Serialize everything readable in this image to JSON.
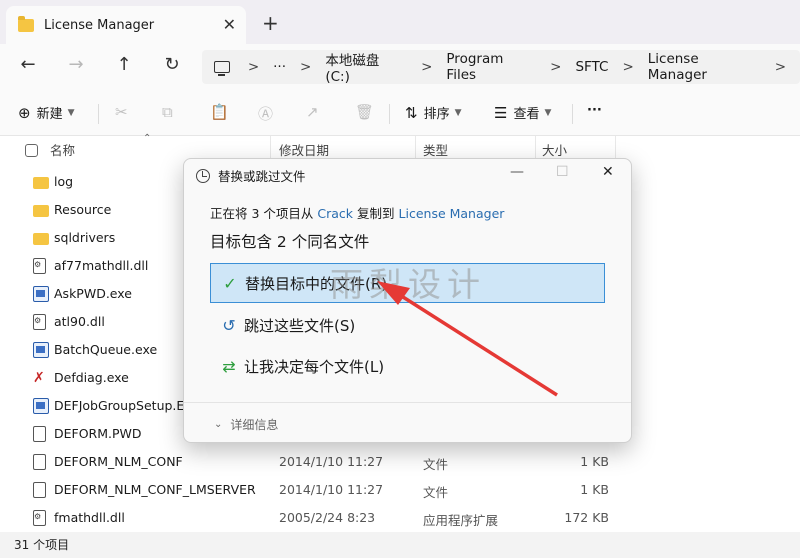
{
  "window": {
    "tab_title": "License Manager",
    "tab_close": "✕",
    "new_tab": "+"
  },
  "nav": {
    "back": "←",
    "forward": "→",
    "up": "↑",
    "refresh": "↻",
    "more": "···",
    "breadcrumbs": [
      "本地磁盘 (C:)",
      "Program Files",
      "SFTC",
      "License Manager"
    ],
    "sep": ">"
  },
  "toolbar": {
    "new_label": "新建",
    "sort_label": "排序",
    "view_label": "查看",
    "more": "···"
  },
  "columns": {
    "name": "名称",
    "modified": "修改日期",
    "type": "类型",
    "size": "大小"
  },
  "files": [
    {
      "name": "log",
      "icon": "folder-icon",
      "date": "",
      "type": "",
      "size": ""
    },
    {
      "name": "Resource",
      "icon": "folder-icon",
      "date": "",
      "type": "",
      "size": ""
    },
    {
      "name": "sqldrivers",
      "icon": "folder-icon",
      "date": "",
      "type": "",
      "size": ""
    },
    {
      "name": "af77mathdll.dll",
      "icon": "dll-icon",
      "date": "",
      "type": "",
      "size": ""
    },
    {
      "name": "AskPWD.exe",
      "icon": "exe-icon",
      "date": "",
      "type": "",
      "size": ""
    },
    {
      "name": "atl90.dll",
      "icon": "dll-icon",
      "date": "",
      "type": "",
      "size": ""
    },
    {
      "name": "BatchQueue.exe",
      "icon": "exe-icon",
      "date": "",
      "type": "",
      "size": ""
    },
    {
      "name": "Defdiag.exe",
      "icon": "defdiag-icon",
      "date": "",
      "type": "",
      "size": ""
    },
    {
      "name": "DEFJobGroupSetup.EX",
      "icon": "exe-icon",
      "date": "",
      "type": "",
      "size": ""
    },
    {
      "name": "DEFORM.PWD",
      "icon": "file-icon",
      "date": "",
      "type": "",
      "size": ""
    },
    {
      "name": "DEFORM_NLM_CONF",
      "icon": "file-icon",
      "date": "2014/1/10 11:27",
      "type": "文件",
      "size": "1 KB"
    },
    {
      "name": "DEFORM_NLM_CONF_LMSERVER",
      "icon": "file-icon",
      "date": "2014/1/10 11:27",
      "type": "文件",
      "size": "1 KB"
    },
    {
      "name": "fmathdll.dll",
      "icon": "dll-icon",
      "date": "2005/2/24 8:23",
      "type": "应用程序扩展",
      "size": "172 KB"
    }
  ],
  "status": {
    "count_text": "31 个项目"
  },
  "dialog": {
    "title": "替换或跳过文件",
    "line1_prefix": "正在将 3 个项目从",
    "source": "Crack",
    "line1_mid": "复制到",
    "dest": "License Manager",
    "line2": "目标包含 2 个同名文件",
    "options": [
      {
        "label": "替换目标中的文件(R)",
        "icon": "✓"
      },
      {
        "label": "跳过这些文件(S)",
        "icon": "↺"
      },
      {
        "label": "让我决定每个文件(L)",
        "icon": "⇄"
      }
    ],
    "details": "详细信息",
    "minimize": "—",
    "maximize": "☐",
    "close": "✕"
  },
  "watermark": "雨梨设计",
  "colors": {
    "accent": "#3b8fd6",
    "selected_bg": "#cfe6f7",
    "link": "#2a6db0",
    "arrow": "#e53935",
    "folder": "#f5c542"
  }
}
